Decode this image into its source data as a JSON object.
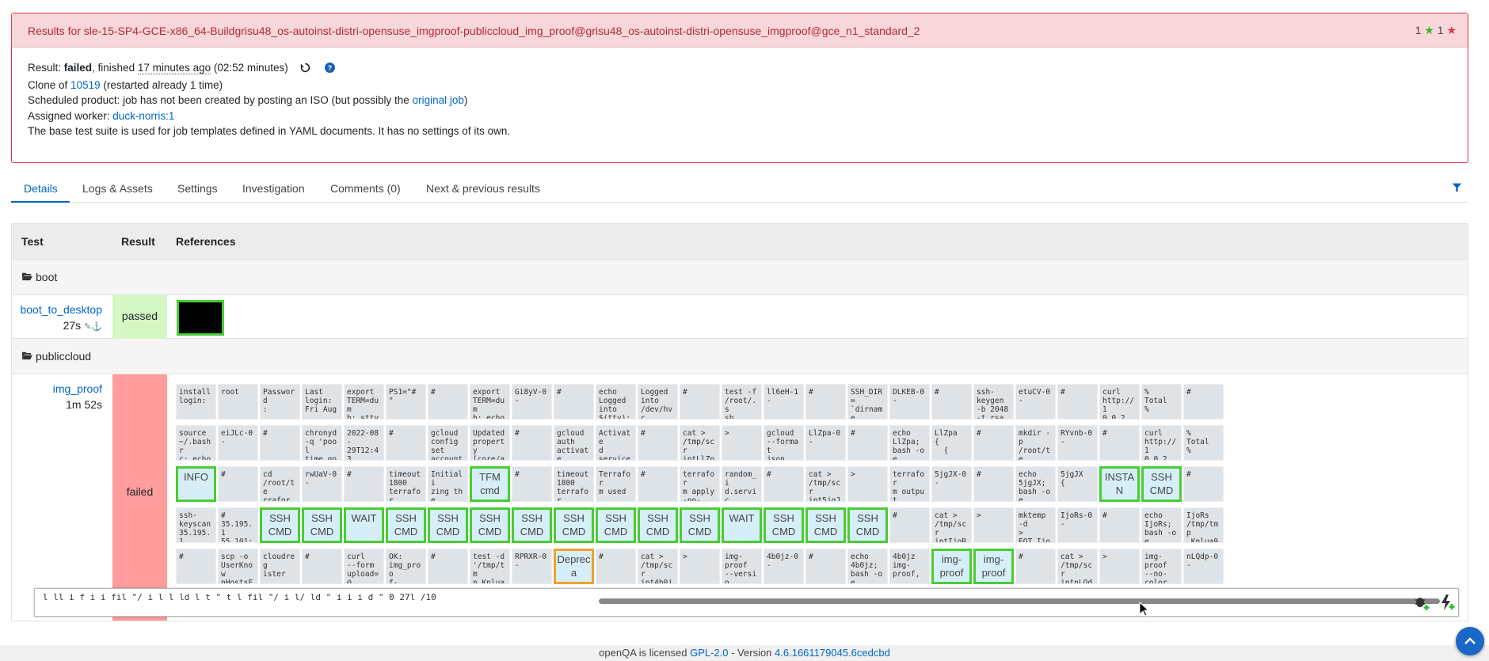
{
  "header": {
    "title": "Results for sle-15-SP4-GCE-x86_64-Buildgrisu48_os-autoinst-distri-opensuse_imgproof-publiccloud_img_proof@grisu48_os-autoinst-distri-opensuse_imgproof@gce_n1_standard_2",
    "passed_count": "1",
    "failed_count": "1"
  },
  "summary": {
    "result_label": "Result: ",
    "result_value": "failed",
    "finished_text": ", finished ",
    "finished_ago": "17 minutes ago",
    "duration": " (02:52 minutes)",
    "clone_prefix": "Clone of ",
    "clone_link": "10519",
    "clone_suffix": " (restarted already 1 time)",
    "scheduled_prefix": "Scheduled product: job has not been created by posting an ISO (but possibly the ",
    "scheduled_link": "original job",
    "scheduled_suffix": ")",
    "worker_prefix": "Assigned worker: ",
    "worker_link": "duck-norris:1",
    "suite_text": "The base test suite is used for job templates defined in YAML documents. It has no settings of its own."
  },
  "tabs": [
    "Details",
    "Logs & Assets",
    "Settings",
    "Investigation",
    "Comments (0)",
    "Next & previous results"
  ],
  "table": {
    "headers": [
      "Test",
      "Result",
      "References"
    ],
    "groups": [
      {
        "name": "boot",
        "test": "boot_to_desktop",
        "time": "27s",
        "result": "passed"
      },
      {
        "name": "publiccloud",
        "test": "img_proof",
        "time": "1m 52s",
        "result": "failed"
      }
    ]
  },
  "grid_rows": [
    [
      "install\nlogin:",
      "root",
      "Password\n:",
      "Last\nlogin:\nFri Aug",
      "export\nTERM=dum\nb; stty\ncols",
      "PS1=\"# \"",
      "#",
      "export\nTERM=dum\nb; echo\nGi8yV-$?",
      "Gi8yV-0-",
      "#",
      "echo\nLogged\ninto\n$(tty);",
      "Logged\ninto\n/dev/hvc",
      "#",
      "test -f\n/root/.s\nsh\n/id_rsa;",
      "ll6eH-1-",
      "#",
      "SSH_DIR=\n`dirname\n/root/.s\nsh",
      "DLKEB-0-",
      "#",
      "ssh-\nkeygen\n-b 2048\n-t rsa",
      "etuCV-0-",
      "#",
      "curl\nhttp://1\n0.0.2.2:\n20013",
      "%\nTotal\n%",
      "#"
    ],
    [
      "source\n~/.bashr\nc; echo\neiJLc-$?",
      "eiJLc-0-",
      "#",
      "chronyd\n-q 'pool\ntime.goo\ngle.com",
      "2022-08-\n29T12:43\n:12Z",
      "#",
      "gcloud\nconfig\nset\naccount",
      "Updated\nproperty\n[core/ac",
      "#",
      "gcloud\nauth\nactivate\n-",
      "Activate\nd\nservice",
      "#",
      "cat >\n/tmp/scr\niptLlZpa\n.sh <<",
      ">",
      "gcloud\n--format\njson\ncompute",
      "LlZpa-0-",
      "#",
      "echo\nLlZpa;\nbash -oe\npipefail",
      "LlZpa\n{\n  {",
      "#",
      "mkdir -p\n/root/te\nrraform;\necho",
      "RYvnb-0-",
      "#",
      "curl\nhttp://1\n0.0.2.2:\n20013",
      "%\nTotal\n%"
    ],
    [
      "INFO",
      "#",
      "cd\n/root/te\nrraform;\necho",
      "rwUaV-0-",
      "#",
      "timeout\n1800\nterrafor\nm init",
      "Initiali\nzing the",
      "TFM\ncmd",
      "#",
      "timeout\n1800\nterrafor\nm plan",
      "Terrafor\nm used",
      "#",
      "terrafor\nm apply\n-no-\ncolor",
      "random_i\nd.servic\ne[0]:",
      "#",
      "cat >\n/tmp/scr\nipt5jgJX\n.sh <<",
      ">",
      "terrafor\nm output\n-json\n>",
      "5jgJX-0-",
      "#",
      "echo\n5jgJX;\nbash -oe\npipefail",
      "5jgJX\n{",
      "INSTAN\nCE",
      "SSH\nCMD",
      "#"
    ],
    [
      "ssh-\nkeyscan\n35.195.1\n55.101",
      "#\n35.195.1\n55.101:2",
      "SSH\nCMD",
      "SSH\nCMD",
      "WAIT",
      "SSH\nCMD",
      "SSH\nCMD",
      "SSH\nCMD",
      "SSH\nCMD",
      "SSH\nCMD",
      "SSH\nCMD",
      "SSH\nCMD",
      "SSH\nCMD",
      "WAIT",
      "SSH\nCMD",
      "SSH\nCMD",
      "SSH\nCMD",
      "#",
      "cat >\n/tmp/scr\niptIjoRs\n.sh <<",
      ">",
      "mktemp\n-d\n>\nEOT_IjoR",
      "IjoRs-0-",
      "#",
      "echo\nIjoRs;\nbash -oe\npipefail",
      "IjoRs\n/tmp/tmp\n.Knlua9b"
    ],
    [
      "#",
      "scp -o\nUserKnow\nnHostsFi\nle=/dev/",
      "cloudreg\nister",
      "#",
      "curl\n--form\nupload=@\n/tmp",
      "OK:\nimg_proo\nf-",
      "#",
      "test -d\n'/tmp/tm\np.Knlua9\nbJSM' &&",
      "RPRXR-0-",
      "Depreca\nted",
      "#",
      "cat >\n/tmp/scr\nipt4b0jz\n.sh <<",
      ">",
      "img-\nproof\n--versio\nn",
      "4b0jz-0-",
      "#",
      "echo\n4b0jz;\nbash -oe\npipefail",
      "4b0jz\nimg-\nproof,",
      "img-\nproof",
      "img-\nproof",
      "#",
      "cat >\n/tmp/scr\niptnLQdp\n.sh <<",
      ">",
      "img-\nproof\n--no-\ncolor",
      "nLQdp-0-"
    ]
  ],
  "console": {
    "text": "l            ll     i  f       i      i   fil  \"/ i   l   l  ld l t     \"          t        l         fil   \"/ i   l/ ld    \"           i   i    i   d  \"           0 27l  /10"
  },
  "footer": {
    "prefix": "openQA is licensed ",
    "license": "GPL-2.0",
    "middle": " - Version ",
    "version": "4.6.1661179045.6cedcbd"
  },
  "colors": {
    "accent": "#0066cc",
    "failed_bg": "#ff9c9c",
    "passed_bg": "#d4f7c4",
    "ok_border": "#49cc35",
    "warn_border": "#f0a030",
    "danger": "#dc3545"
  }
}
